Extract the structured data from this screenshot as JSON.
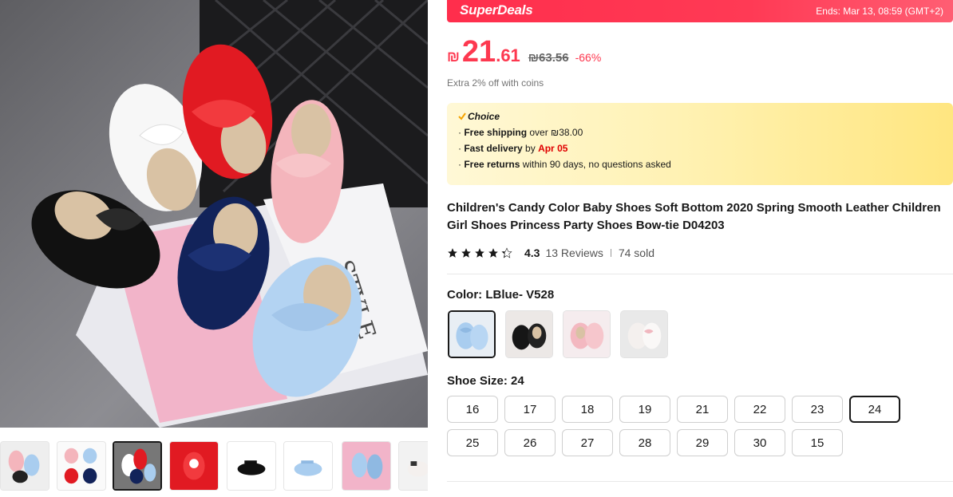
{
  "superdeals": {
    "brand": "SuperDeals",
    "ends": "Ends: Mar 13, 08:59 (GMT+2)"
  },
  "price": {
    "currency": "₪",
    "integer": "21",
    "decimal": ".61",
    "original": "₪63.56",
    "discount": "-66%",
    "coins_note": "Extra 2% off with coins"
  },
  "choice": {
    "title": "Choice",
    "shipping_label": "Free shipping",
    "shipping_rest": " over ₪38.00",
    "delivery_label": "Fast delivery",
    "delivery_by": " by ",
    "delivery_date": "Apr 05",
    "returns_label": "Free returns",
    "returns_rest": "  within 90 days, no questions asked"
  },
  "product": {
    "title": "Children's Candy Color Baby Shoes Soft Bottom 2020 Spring Smooth Leather Children Girl Shoes Princess Party Shoes Bow-tie D04203",
    "rating": "4.3",
    "rating_value": 4.3,
    "reviews": "13 Reviews",
    "sold": "74 sold"
  },
  "color": {
    "label": "Color: LBlue- V528",
    "swatches": [
      {
        "name": "LBlue- V528",
        "selected": true,
        "shoe_color": "#a9cdef"
      },
      {
        "name": "black",
        "selected": false,
        "shoe_color": "#161616"
      },
      {
        "name": "pink",
        "selected": false,
        "shoe_color": "#f3b8c0"
      },
      {
        "name": "white",
        "selected": false,
        "shoe_color": "#f4f0ee"
      }
    ]
  },
  "size": {
    "label": "Shoe Size: 24",
    "options": [
      "16",
      "17",
      "18",
      "19",
      "21",
      "22",
      "23",
      "24",
      "25",
      "26",
      "27",
      "28",
      "29",
      "30",
      "15"
    ],
    "selected": "24"
  },
  "colors": {
    "accent": "#fd384f",
    "superdeals_bg": "#ff2e4c",
    "choice_bg": "#fff2b4",
    "delivery_date": "#e00000"
  }
}
